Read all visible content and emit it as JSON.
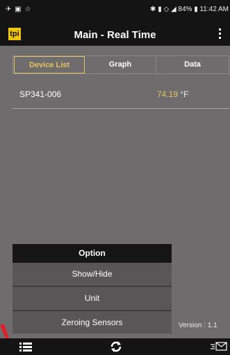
{
  "status_bar": {
    "left_icons": "✈ ▣ ☆",
    "bluetooth_signal_battery": "✱ ▮ ◇ ◢ 84% ▮",
    "time": "11:42 AM"
  },
  "app_bar": {
    "logo_text": "tpi",
    "title": "Main - Real Time"
  },
  "tabs": [
    {
      "label": "Device List",
      "active": true
    },
    {
      "label": "Graph",
      "active": false
    },
    {
      "label": "Data",
      "active": false
    }
  ],
  "device_row": {
    "device": "SP341-006",
    "value": "74.19",
    "unit": "°F"
  },
  "option_menu": {
    "header": "Option",
    "items": [
      "Show/Hide",
      "Unit",
      "Zeroing Sensors"
    ]
  },
  "version": "Version : 1.1",
  "colors": {
    "accent": "#e7c45d",
    "background": "#6e6c6c",
    "bars": "#141414",
    "arrow": "#e0202a"
  }
}
